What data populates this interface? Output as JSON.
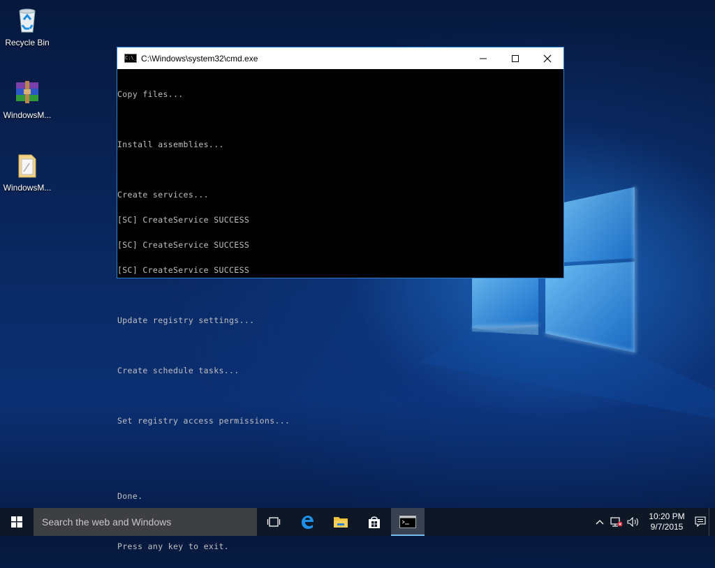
{
  "desktop": {
    "icons": [
      {
        "label": "Recycle Bin",
        "icon": "recycle-bin-icon"
      },
      {
        "label": "WindowsM...",
        "icon": "winrar-archive-icon"
      },
      {
        "label": "WindowsM...",
        "icon": "folder-icon"
      }
    ]
  },
  "window": {
    "title": "C:\\Windows\\system32\\cmd.exe",
    "icon": "cmd-icon",
    "icon_text": "C:\\_",
    "buttons": [
      "minimize-icon",
      "maximize-icon",
      "close-icon"
    ],
    "console_lines": [
      "Copy files...",
      "",
      "Install assemblies...",
      "",
      "Create services...",
      "[SC] CreateService SUCCESS",
      "[SC] CreateService SUCCESS",
      "[SC] CreateService SUCCESS",
      "",
      "Update registry settings...",
      "",
      "Create schedule tasks...",
      "",
      "Set registry access permissions...",
      "",
      "",
      "Done.",
      "",
      "Press any key to exit."
    ]
  },
  "taskbar": {
    "search_placeholder": "Search the web and Windows",
    "pinned": [
      "task-view-icon",
      "edge-icon",
      "file-explorer-icon",
      "store-icon",
      "cmd-icon"
    ],
    "active": "cmd-icon",
    "tray_icons": [
      "chevron-up-icon",
      "network-error-icon",
      "volume-icon",
      "action-center-icon"
    ],
    "time": "10:20 PM",
    "date": "9/7/2015"
  },
  "colors": {
    "accent": "#2f7fd0",
    "taskbar_bg": "#0e1726",
    "console_bg": "#000000",
    "console_text": "#c0c0c0"
  }
}
